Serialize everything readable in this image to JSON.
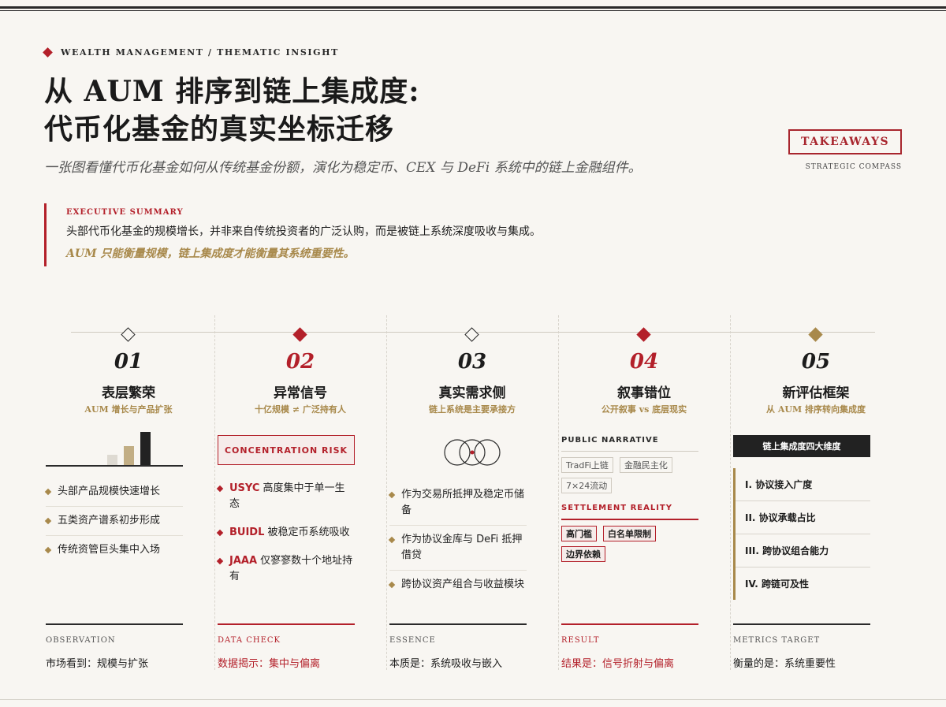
{
  "kicker": "WEALTH MANAGEMENT / THEMATIC INSIGHT",
  "title_line1": "从 AUM 排序到链上集成度:",
  "title_line2": "代币化基金的真实坐标迁移",
  "subtitle": "一张图看懂代币化基金如何从传统基金份额，演化为稳定币、CEX 与 DeFi 系统中的链上金融组件。",
  "badge": "TAKEAWAYS",
  "badge_sub": "STRATEGIC COMPASS",
  "summary": {
    "label": "EXECUTIVE SUMMARY",
    "line1": "头部代币化基金的规模增长，并非来自传统投资者的广泛认购，而是被链上系统深度吸收与集成。",
    "line2": "AUM 只能衡量规模，链上集成度才能衡量其系统重要性。"
  },
  "colors": {
    "red": "#b3202a",
    "gold": "#a8894b",
    "dark": "#222222"
  },
  "cols": [
    {
      "num": "01",
      "head": "表层繁荣",
      "sub": "AUM 增长与产品扩张",
      "bullets": [
        "头部产品规模快速增长",
        "五类资产谱系初步形成",
        "传统资管巨头集中入场"
      ],
      "foot_label": "OBSERVATION",
      "foot_value": "市场看到：规模与扩张"
    },
    {
      "num": "02",
      "head": "异常信号",
      "sub": "十亿规模 ≠ 广泛持有人",
      "box": "CONCENTRATION RISK",
      "bullets": [
        {
          "b": "USYC",
          "t": " 高度集中于单一生态"
        },
        {
          "b": "BUIDL",
          "t": " 被稳定币系统吸收"
        },
        {
          "b": "JAAA",
          "t": " 仅寥寥数十个地址持有"
        }
      ],
      "foot_label": "DATA CHECK",
      "foot_value": "数据揭示：集中与偏离"
    },
    {
      "num": "03",
      "head": "真实需求侧",
      "sub": "链上系统是主要承接方",
      "bullets": [
        "作为交易所抵押及稳定币储备",
        "作为协议金库与 DeFi 抵押借贷",
        "跨协议资产组合与收益模块"
      ],
      "foot_label": "ESSENCE",
      "foot_value": "本质是：系统吸收与嵌入"
    },
    {
      "num": "04",
      "head": "叙事错位",
      "sub": "公开叙事 vs 底层现实",
      "public_label": "PUBLIC NARRATIVE",
      "public_tags": [
        "TradFi上链",
        "金融民主化",
        "7×24流动"
      ],
      "settle_label": "SETTLEMENT REALITY",
      "settle_tags": [
        "高门槛",
        "白名单限制",
        "边界依赖"
      ],
      "foot_label": "RESULT",
      "foot_value": "结果是：信号折射与偏离"
    },
    {
      "num": "05",
      "head": "新评估框架",
      "sub": "从 AUM 排序转向集成度",
      "box": "链上集成度四大维度",
      "dims": [
        "I. 协议接入广度",
        "II. 协议承载占比",
        "III. 跨协议组合能力",
        "IV. 跨链可及性"
      ],
      "foot_label": "METRICS TARGET",
      "foot_value": "衡量的是：系统重要性"
    }
  ],
  "mini_chart": {
    "values": [
      0.3,
      0.55,
      0.95
    ]
  }
}
